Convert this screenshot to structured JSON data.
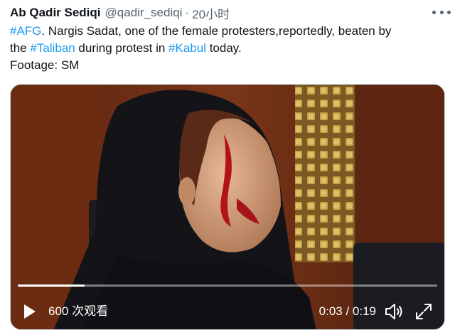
{
  "tweet": {
    "author_name": "Ab Qadir Sediqi",
    "author_handle": "@qadir_sediqi",
    "separator": "·",
    "time_ago": "20小时",
    "text": {
      "hashtag_afg": "#AFG",
      "part1": ". Nargis Sadat, one of the female protesters,reportedly, beaten by",
      "part2": "the ",
      "hashtag_taliban": "#Taliban",
      "part3": " during protest in ",
      "hashtag_kabul": "#Kabul",
      "part4": " today.",
      "footage": "Footage: SM"
    }
  },
  "video": {
    "views": "600 次观看",
    "timecode": "0:03 / 0:19",
    "progress": 0.16
  },
  "icons": {
    "more": "more-dots-icon",
    "play": "play-icon",
    "volume": "volume-icon",
    "fullscreen": "expand-icon"
  },
  "colors": {
    "hashtag": "#1d9bf0",
    "secondary_text": "#536471"
  }
}
